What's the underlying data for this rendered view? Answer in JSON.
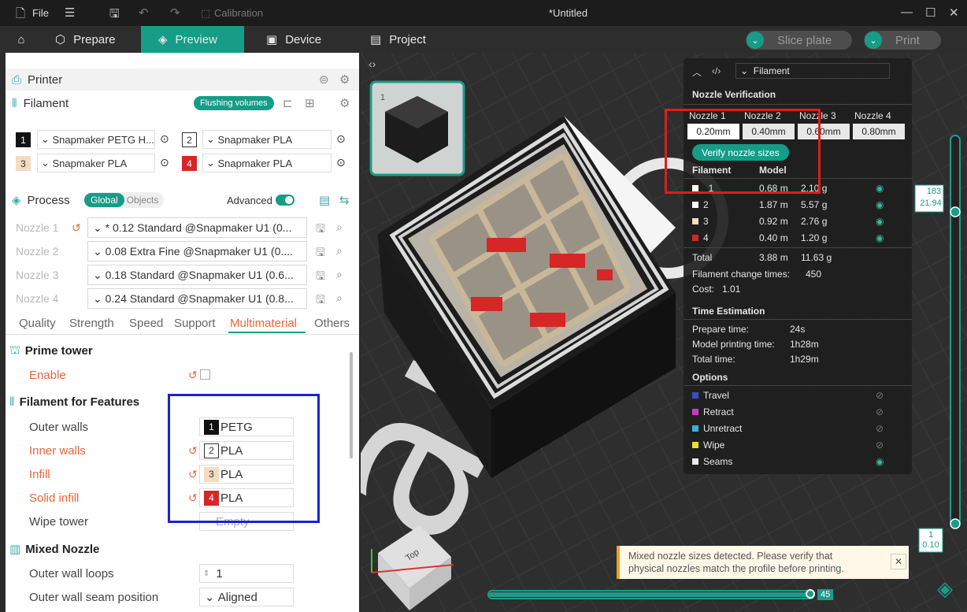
{
  "window": {
    "file_menu": "File",
    "calibration": "Calibration",
    "title": "*Untitled"
  },
  "tabs": {
    "prepare": "Prepare",
    "preview": "Preview",
    "device": "Device",
    "project": "Project"
  },
  "actions": {
    "slice": "Slice plate",
    "print": "Print"
  },
  "left": {
    "printer": "Printer",
    "filament": "Filament",
    "flushing": "Flushing volumes",
    "filaments": [
      {
        "num": "1",
        "name": "Snapmaker PETG H...",
        "color": "#111111"
      },
      {
        "num": "2",
        "name": "Snapmaker PLA",
        "color": "#ffffff"
      },
      {
        "num": "3",
        "name": "Snapmaker PLA",
        "color": "#f3dcc0"
      },
      {
        "num": "4",
        "name": "Snapmaker PLA",
        "color": "#d62626"
      }
    ],
    "process": "Process",
    "global": "Global",
    "objects": "Objects",
    "advanced": "Advanced",
    "nozzles": [
      {
        "label": "Nozzle 1",
        "profile": "* 0.12 Standard @Snapmaker U1 (0..."
      },
      {
        "label": "Nozzle 2",
        "profile": "0.08 Extra Fine @Snapmaker U1 (0...."
      },
      {
        "label": "Nozzle 3",
        "profile": "0.18 Standard @Snapmaker U1 (0.6..."
      },
      {
        "label": "Nozzle 4",
        "profile": "0.24 Standard @Snapmaker U1 (0.8..."
      }
    ],
    "ptabs": [
      "Quality",
      "Strength",
      "Speed",
      "Support",
      "Multimaterial",
      "Others"
    ],
    "prime_tower": "Prime tower",
    "enable": "Enable",
    "features_title": "Filament for Features",
    "features": [
      {
        "label": "Outer walls",
        "num": "1",
        "val": "PETG"
      },
      {
        "label": "Inner walls",
        "num": "2",
        "val": "PLA"
      },
      {
        "label": "Infill",
        "num": "3",
        "val": "PLA"
      },
      {
        "label": "Solid infill",
        "num": "4",
        "val": "PLA"
      },
      {
        "label": "Wipe tower",
        "val": "Empty"
      }
    ],
    "mixed_nozzle": "Mixed Nozzle",
    "outer_wall_loops": "Outer wall loops",
    "outer_wall_loops_val": "1",
    "seam_pos": "Outer wall seam position",
    "seam_val": "Aligned"
  },
  "overlay": {
    "view": "Filament",
    "verify_title": "Nozzle Verification",
    "nozzle_labels": [
      "Nozzle 1",
      "Nozzle 2",
      "Nozzle 3",
      "Nozzle 4"
    ],
    "nozzle_sizes": [
      "0.20mm",
      "0.40mm",
      "0.60mm",
      "0.80mm"
    ],
    "verify_btn": "Verify nozzle sizes",
    "col_filament": "Filament",
    "col_model": "Model",
    "rows": [
      {
        "n": "1",
        "len": "0.68 m",
        "w": "2.10 g",
        "color": "#ffffff"
      },
      {
        "n": "2",
        "len": "1.87 m",
        "w": "5.57 g",
        "color": "#ffffff"
      },
      {
        "n": "3",
        "len": "0.92 m",
        "w": "2.76 g",
        "color": "#f3dcc0"
      },
      {
        "n": "4",
        "len": "0.40 m",
        "w": "1.20 g",
        "color": "#d62626"
      }
    ],
    "total_label": "Total",
    "total_len": "3.88 m",
    "total_w": "11.63 g",
    "change_times": "Filament change times:",
    "change_val": "450",
    "cost_label": "Cost:",
    "cost_val": "1.01",
    "time_title": "Time Estimation",
    "prepare_time": "Prepare time:",
    "prepare_val": "24s",
    "model_time": "Model printing time:",
    "model_val": "1h28m",
    "total_time": "Total time:",
    "total_val": "1h29m",
    "options_title": "Options",
    "options": [
      {
        "name": "Travel",
        "color": "#3a4fb8"
      },
      {
        "name": "Retract",
        "color": "#c83ac8"
      },
      {
        "name": "Unretract",
        "color": "#3ab0d8"
      },
      {
        "name": "Wipe",
        "color": "#f0e020"
      },
      {
        "name": "Seams",
        "color": "#e8e8e8"
      }
    ]
  },
  "slider": {
    "top_layer": "183",
    "top_height": "21.94",
    "bottom_layer": "1",
    "bottom_height": "0.10",
    "h_value": "45"
  },
  "toast": {
    "text1": "Mixed nozzle sizes detected. Please verify that",
    "text2": "physical nozzles match the profile before printing."
  },
  "cube_label": "Top",
  "plate_num": "1"
}
